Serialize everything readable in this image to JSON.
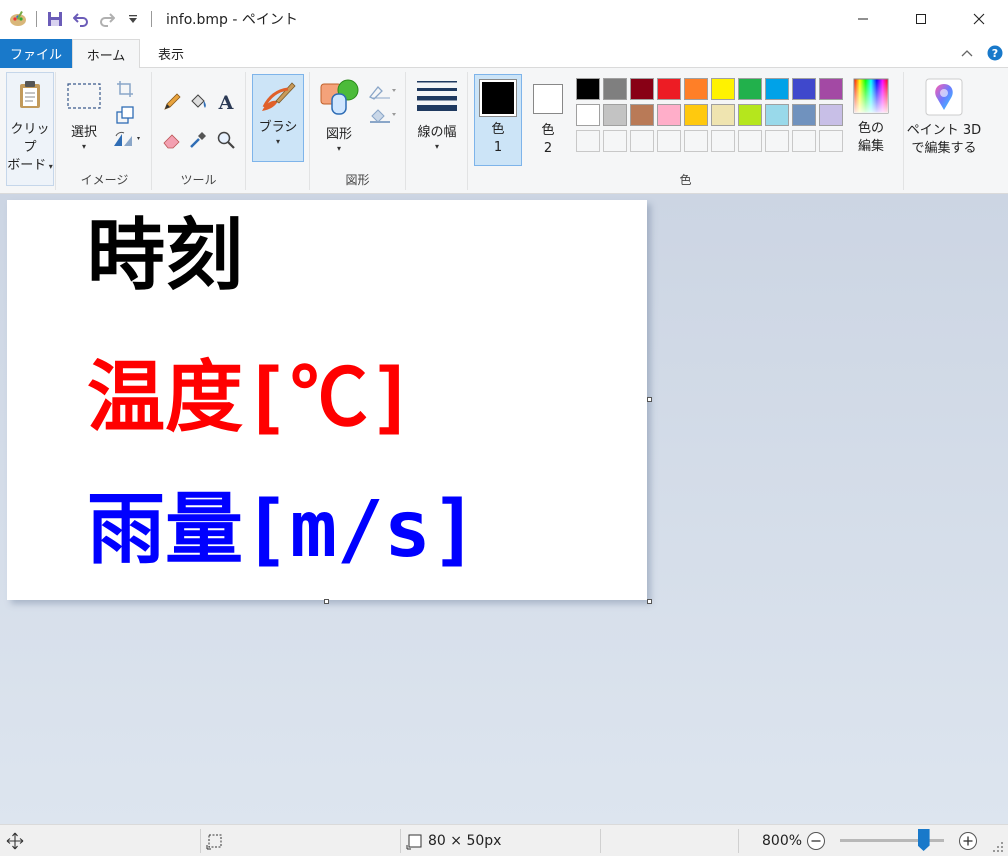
{
  "window": {
    "title": "info.bmp - ペイント",
    "controls": [
      "minimize",
      "maximize",
      "close"
    ]
  },
  "tabs": {
    "file": "ファイル",
    "home": "ホーム",
    "view": "表示"
  },
  "ribbon": {
    "clipboard": {
      "label_line1": "クリップ",
      "label_line2": "ボード"
    },
    "image": {
      "select": "選択",
      "group": "イメージ"
    },
    "tools": {
      "group": "ツール"
    },
    "brush": {
      "label": "ブラシ"
    },
    "shapes": {
      "label": "図形",
      "group": "図形"
    },
    "size": {
      "label": "線の幅"
    },
    "colors": {
      "color1_l1": "色",
      "color1_l2": "1",
      "color2_l1": "色",
      "color2_l2": "2",
      "edit_l1": "色の",
      "edit_l2": "編集",
      "group": "色",
      "palette_row1": [
        "#000000",
        "#7f7f7f",
        "#880015",
        "#ed1c24",
        "#ff7f27",
        "#fff200",
        "#22b14c",
        "#00a2e8",
        "#3f48cc",
        "#a349a4"
      ],
      "palette_row2": [
        "#ffffff",
        "#c3c3c3",
        "#b97a57",
        "#ffaec9",
        "#ffc90e",
        "#efe4b0",
        "#b5e61d",
        "#99d9ea",
        "#7092be",
        "#c8bfe7"
      ],
      "color1": "#000000",
      "color2": "#ffffff"
    },
    "paint3d": {
      "l1": "ペイント 3D",
      "l2": "で編集する"
    }
  },
  "canvas": {
    "lines": [
      {
        "text": "時刻",
        "color": "#000000"
      },
      {
        "text": "温度[℃]",
        "color": "#ff0000"
      },
      {
        "text": "雨量[m/s]",
        "color": "#0000ff"
      }
    ]
  },
  "status": {
    "image_size": "80 × 50px",
    "zoom": "800%",
    "zoom_level_fraction": 0.8
  }
}
